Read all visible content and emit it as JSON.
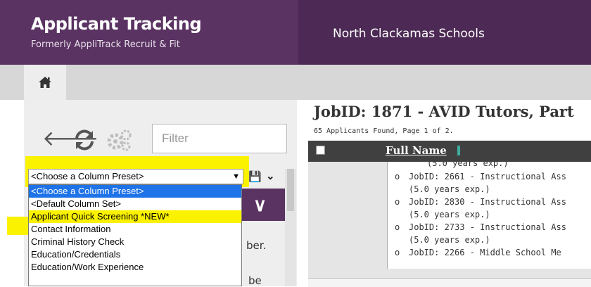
{
  "header": {
    "app_title": "Applicant Tracking",
    "app_subtitle": "Formerly AppliTrack Recruit & Fit",
    "org_name": "North Clackamas Schools"
  },
  "colors": {
    "header_purple": "#5a3362",
    "highlight_yellow": "#fbf200",
    "selected_blue": "#1e73e8",
    "grid_header": "#404040"
  },
  "nav": {
    "home_icon": "home-icon"
  },
  "toolbar": {
    "icons": [
      "back-arrow-icon",
      "refresh-icon",
      "gears-icon"
    ],
    "filter_placeholder": "Filter"
  },
  "preset": {
    "selected": "<Choose a Column Preset>",
    "options": [
      "<Choose a Column Preset>",
      "<Default Column Set>",
      "Applicant Quick Screening *NEW*",
      "Contact Information",
      "Criminal History Check",
      "Education/Credentials",
      "Education/Work Experience"
    ]
  },
  "background_text": {
    "fragment_1": "ber.",
    "fragment_2": "be"
  },
  "main": {
    "title": "JobID: 1871 - AVID Tutors, Part",
    "count": "65 Applicants Found, Page 1 of 2.",
    "column_header": "Full Name",
    "jobs": [
      "(5.0 years exp.)",
      "JobID: 2661 - Instructional Ass",
      "(5.0 years exp.)",
      "JobID: 2830 - Instructional Ass",
      "(5.0 years exp.)",
      "JobID: 2733 - Instructional Ass",
      "(5.0 years exp.)",
      "JobID: 2266 - Middle School Me"
    ]
  }
}
